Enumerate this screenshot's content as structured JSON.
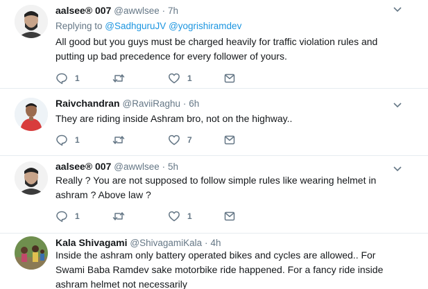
{
  "tweets": [
    {
      "name": "aalsee® 007",
      "handle": "@awwlsee",
      "dot": "·",
      "time": "7h",
      "reply_prefix": "Replying to ",
      "reply_to_1": "@SadhguruJV",
      "reply_to_2": "@yogrishiramdev",
      "text": "All good but you guys must be charged heavily for traffic violation rules and putting up bad precedence for every follower of yours.",
      "reply_count": "1",
      "retweet_count": "",
      "like_count": "1"
    },
    {
      "name": "Raivchandran",
      "handle": "@RaviiRaghu",
      "dot": "·",
      "time": "6h",
      "text": "They are riding inside Ashram bro, not on the highway..",
      "reply_count": "1",
      "retweet_count": "",
      "like_count": "7"
    },
    {
      "name": "aalsee® 007",
      "handle": "@awwlsee",
      "dot": "·",
      "time": "5h",
      "text": "Really ? You are not supposed to follow simple rules like wearing helmet in ashram ? Above law ?",
      "reply_count": "1",
      "retweet_count": "",
      "like_count": "1"
    },
    {
      "name": "Kala Shivagami",
      "handle": "@ShivagamiKala",
      "dot": "·",
      "time": "4h",
      "text": "Inside the ashram only battery operated bikes and cycles are allowed.. For Swami Baba Ramdev sake motorbike ride happened. For a fancy ride inside ashram helmet not necessarily"
    }
  ],
  "icons": {
    "reply": "reply-icon",
    "retweet": "retweet-icon",
    "like": "heart-icon",
    "dm": "envelope-icon",
    "caret": "chevron-down-icon"
  },
  "colors": {
    "link": "#1b95e0",
    "muted": "#657786",
    "text": "#14171a",
    "divider": "#e6ecf0"
  }
}
